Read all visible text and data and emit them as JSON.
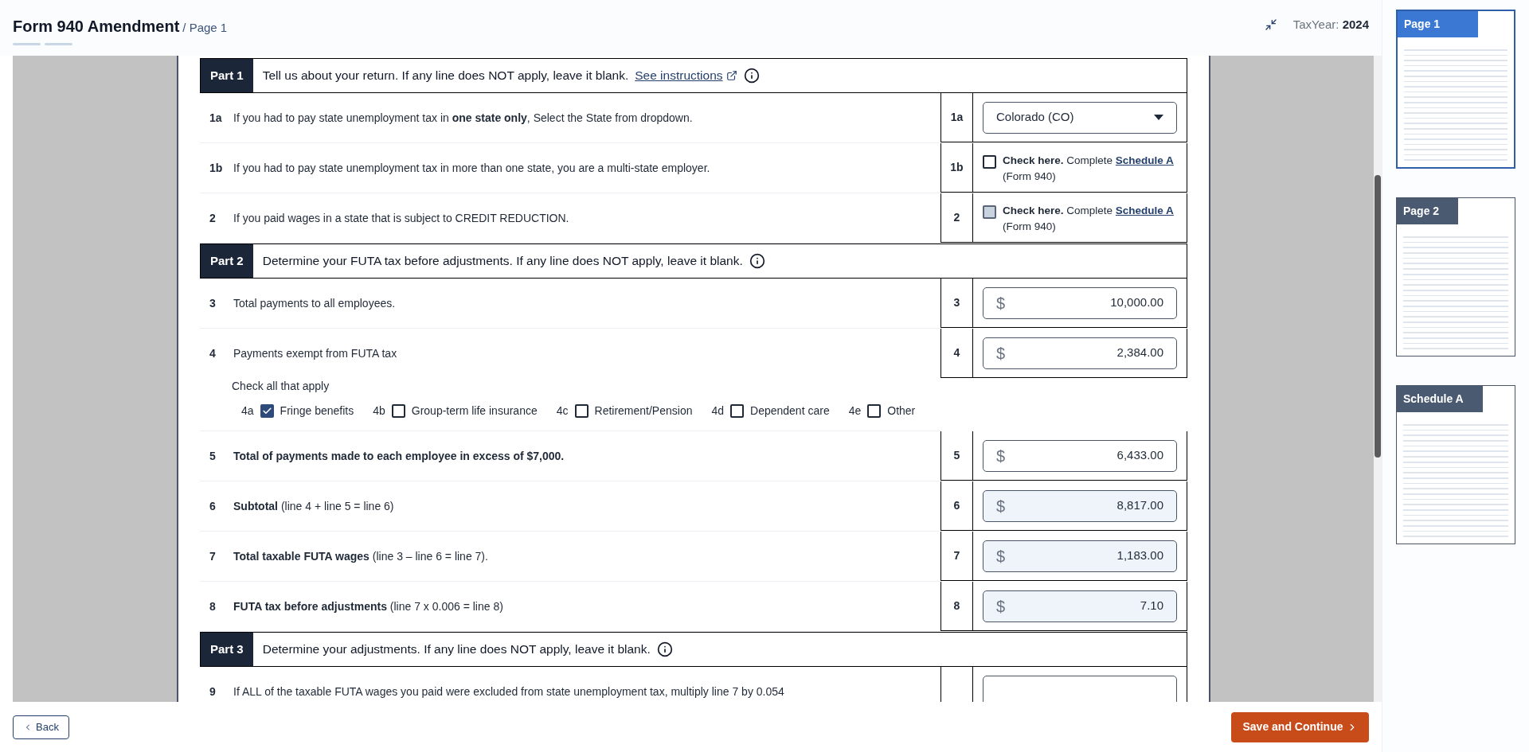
{
  "header": {
    "title": "Form 940 Amendment",
    "page_label": "/ Page 1",
    "tax_year_label": "TaxYear:",
    "tax_year": "2024"
  },
  "parts": [
    {
      "label": "Part 1",
      "title": "Tell us about your return. If any line does NOT apply, leave it blank.",
      "link": "See instructions",
      "lines": [
        {
          "kind": "select",
          "number": "1a",
          "text": "If you had to pay state unemployment tax in **one state only**, Select the State from dropdown.",
          "box_number": "1a",
          "value": "Colorado (CO)"
        },
        {
          "kind": "checkbox",
          "number": "1b",
          "text": "If you had to pay state unemployment tax in more than one state, you are a multi-state employer.",
          "box_number": "1b",
          "checked": false,
          "disabled": false,
          "check_text": "**Check here.** Complete",
          "link": "Schedule A",
          "note": "(Form 940)"
        },
        {
          "kind": "checkbox",
          "number": "2",
          "text": "If you paid wages in a state that is subject to CREDIT REDUCTION.",
          "box_number": "2",
          "checked": false,
          "disabled": true,
          "check_text": "**Check here.** Complete",
          "link": "Schedule A",
          "note": "(Form 940)"
        }
      ]
    },
    {
      "label": "Part 2",
      "title": "Determine your FUTA tax before adjustments. If any line does NOT apply, leave it blank.",
      "lines": [
        {
          "kind": "amount",
          "number": "3",
          "text": "Total payments to all employees.",
          "box_number": "3",
          "currency": "$",
          "value": "10,000.00",
          "readonly": false
        },
        {
          "kind": "amount",
          "number": "4",
          "text": "Payments exempt from FUTA tax",
          "box_number": "4",
          "currency": "$",
          "value": "2,384.00",
          "readonly": false,
          "options": {
            "title": "Check all that apply",
            "items": [
              {
                "code": "4a",
                "label": "Fringe benefits",
                "checked": true
              },
              {
                "code": "4b",
                "label": "Group-term life insurance",
                "checked": false
              },
              {
                "code": "4c",
                "label": "Retirement/Pension",
                "checked": false
              },
              {
                "code": "4d",
                "label": "Dependent care",
                "checked": false
              },
              {
                "code": "4e",
                "label": "Other",
                "checked": false
              }
            ]
          }
        },
        {
          "kind": "amount",
          "number": "5",
          "text": "**Total of payments made to each employee in excess of $7,000.**",
          "box_number": "5",
          "currency": "$",
          "value": "6,433.00",
          "readonly": false
        },
        {
          "kind": "amount",
          "number": "6",
          "text": "**Subtotal** (line 4 + line 5 = line 6)",
          "box_number": "6",
          "currency": "$",
          "value": "8,817.00",
          "readonly": true
        },
        {
          "kind": "amount",
          "number": "7",
          "text": "**Total taxable FUTA wages** (line 3 – line 6 = line 7).",
          "box_number": "7",
          "currency": "$",
          "value": "1,183.00",
          "readonly": true
        },
        {
          "kind": "amount",
          "number": "8",
          "text": "**FUTA tax before adjustments** (line 7 x 0.006 = line 8)",
          "box_number": "8",
          "currency": "$",
          "value": "7.10",
          "readonly": true
        }
      ]
    },
    {
      "label": "Part 3",
      "title": "Determine your adjustments. If any line does NOT apply, leave it blank.",
      "lines": [
        {
          "kind": "amount",
          "number": "9",
          "text": "If ALL of the taxable FUTA wages you paid were excluded from state unemployment tax, multiply line 7 by 0.054",
          "readonly": false
        }
      ]
    }
  ],
  "thumbnails": [
    {
      "label": "Page 1",
      "selected": true
    },
    {
      "label": "Page 2",
      "selected": false
    },
    {
      "label": "Schedule A",
      "selected": false
    }
  ],
  "footer": {
    "back": "Back",
    "next": "Save and Continue"
  }
}
